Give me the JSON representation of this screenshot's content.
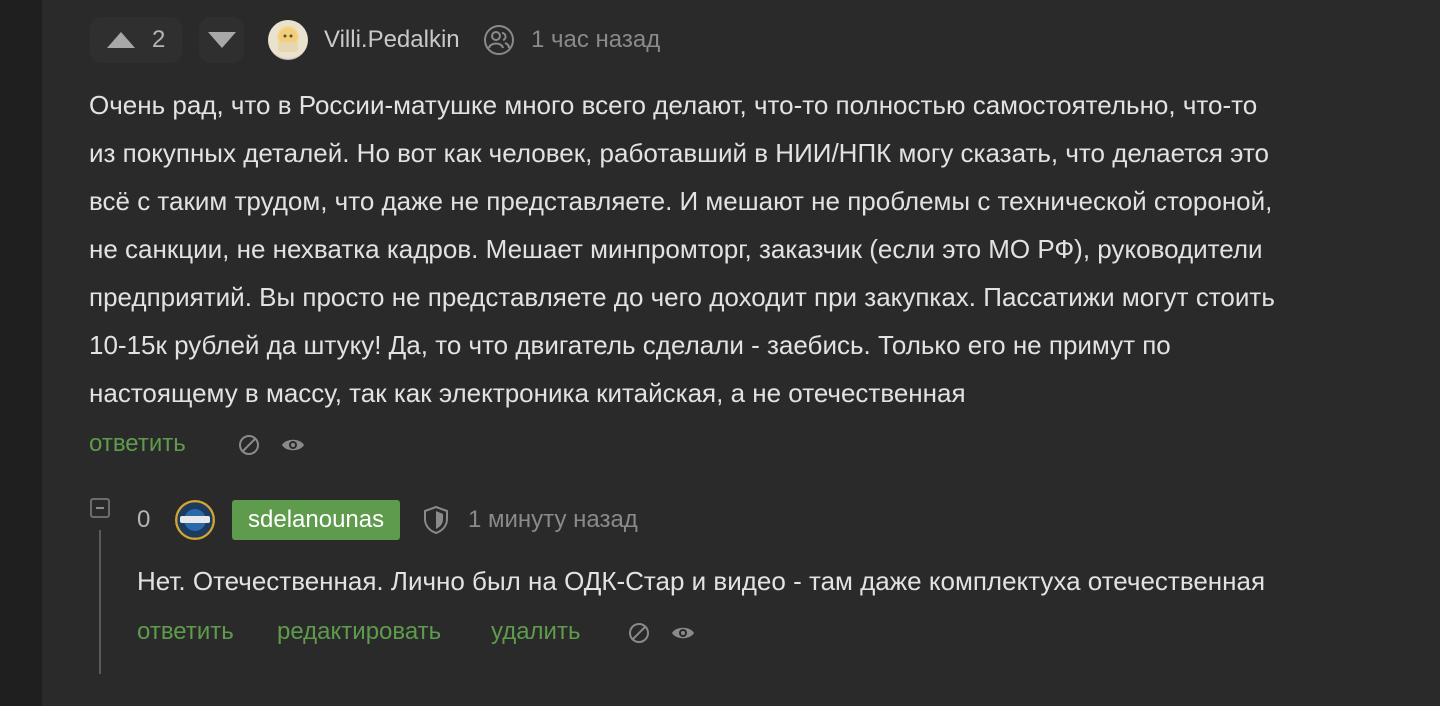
{
  "comment": {
    "rating": "2",
    "author": "Villi.Pedalkin",
    "time": "1 час назад",
    "text_lines": [
      "Очень рад, что в России-матушке много всего делают, что-то полностью самостоятельно, что-то",
      "из покупных деталей. Но вот как человек, работавший в НИИ/НПК могу сказать, что делается это",
      "всё с таким трудом, что даже не представляете. И мешают не проблемы с технической стороной,",
      "не санкции, не нехватка кадров. Мешает минпромторг, заказчик (если это МО РФ), руководители",
      "предприятий. Вы просто не представляете до чего доходит при закупках. Пассатижи могут стоить",
      "10-15к рублей да штуку! Да, то что двигатель сделали - заебись. Только его не примут по",
      "настоящему в массу, так как электроника китайская, а не отечественная"
    ],
    "reply_label": "ответить",
    "icons": {
      "upvote": "arrow-up-icon",
      "downvote": "arrow-down-icon",
      "author_badge": "user-icon",
      "hide": "hide-icon",
      "view": "eye-icon"
    }
  },
  "reply": {
    "rating": "0",
    "author": "sdelanounas",
    "time": "1 минуту назад",
    "text": "Нет. Отечественная. Лично был на ОДК-Стар и видео - там даже комплектуха отечественная",
    "reply_label": "ответить",
    "edit_label": "редактировать",
    "delete_label": "удалить",
    "icons": {
      "collapse": "collapse-icon",
      "author_badge": "shield-icon",
      "hide": "hide-icon",
      "view": "eye-icon"
    }
  },
  "colors": {
    "page_bg": "#1f1f1f",
    "panel_bg": "#2a2a2a",
    "accent_green": "#5e9b4c",
    "text": "#e2e2e2",
    "muted": "#8a8a8a"
  }
}
